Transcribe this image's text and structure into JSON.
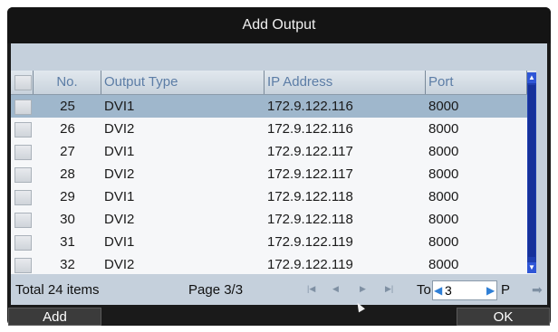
{
  "dialog": {
    "title": "Add Output"
  },
  "table": {
    "headers": {
      "no": "No.",
      "type": "Output Type",
      "ip": "IP Address",
      "port": "Port"
    },
    "rows": [
      {
        "no": "25",
        "type": "DVI1",
        "ip": "172.9.122.116",
        "port": "8000",
        "selected": true
      },
      {
        "no": "26",
        "type": "DVI2",
        "ip": "172.9.122.116",
        "port": "8000"
      },
      {
        "no": "27",
        "type": "DVI1",
        "ip": "172.9.122.117",
        "port": "8000"
      },
      {
        "no": "28",
        "type": "DVI2",
        "ip": "172.9.122.117",
        "port": "8000"
      },
      {
        "no": "29",
        "type": "DVI1",
        "ip": "172.9.122.118",
        "port": "8000"
      },
      {
        "no": "30",
        "type": "DVI2",
        "ip": "172.9.122.118",
        "port": "8000"
      },
      {
        "no": "31",
        "type": "DVI1",
        "ip": "172.9.122.119",
        "port": "8000"
      },
      {
        "no": "32",
        "type": "DVI2",
        "ip": "172.9.122.119",
        "port": "8000"
      }
    ]
  },
  "footer": {
    "total": "Total 24 items",
    "page": "Page 3/3",
    "to_label": "To",
    "page_input": "3",
    "page_suffix": "P",
    "nav_icons": [
      "first-page-icon",
      "prev-page-icon",
      "next-page-icon",
      "last-page-icon"
    ]
  },
  "buttons": {
    "add": "Add",
    "ok": "OK"
  },
  "colors": {
    "selected_row": "#9fb7cc",
    "scrollbar": "#1f3fb0",
    "header_text": "#5c7da6"
  }
}
